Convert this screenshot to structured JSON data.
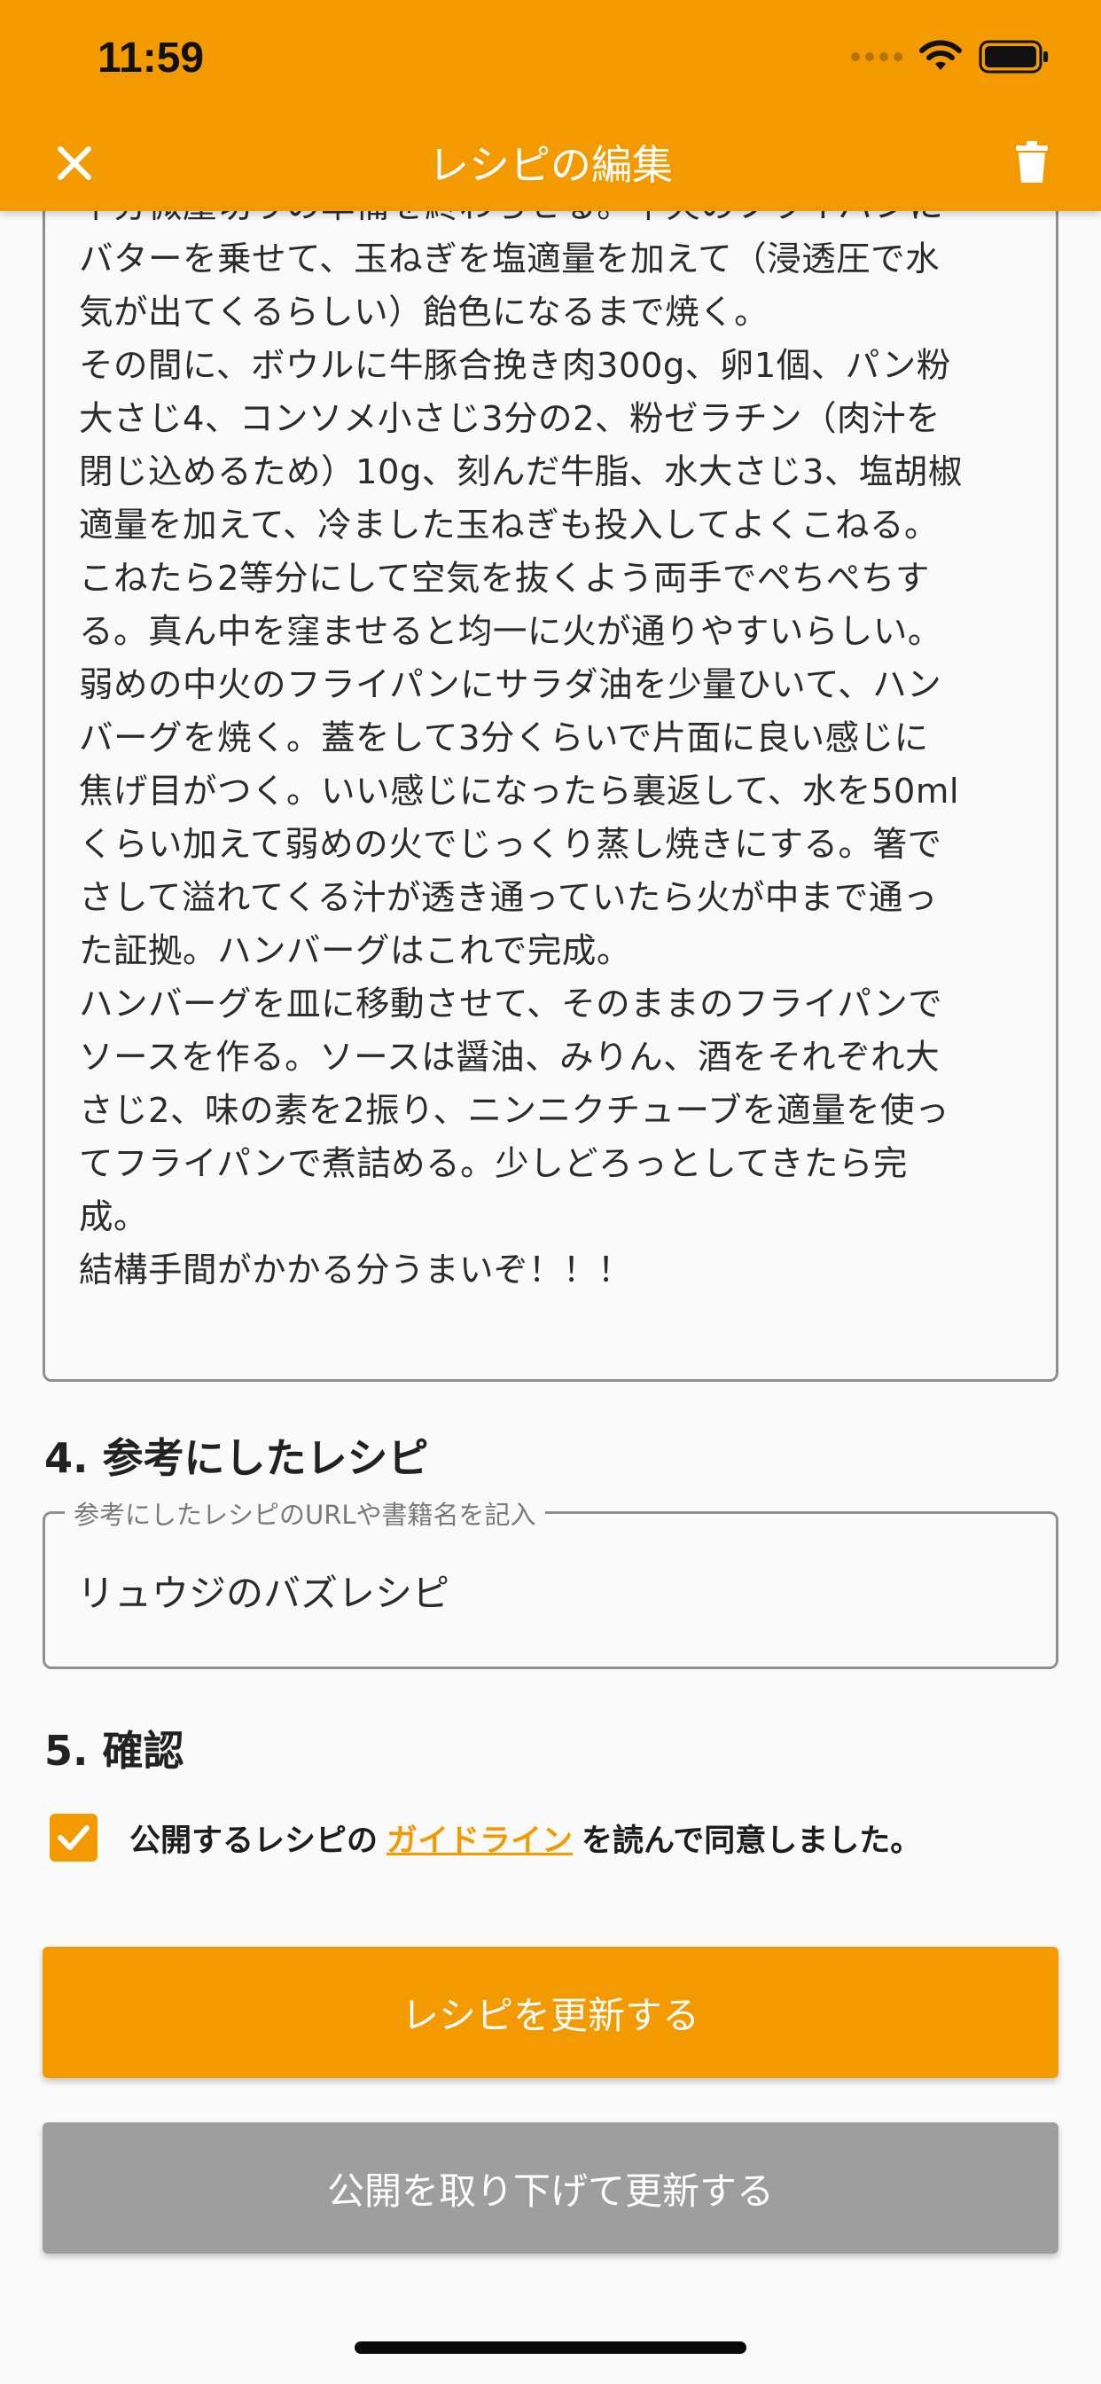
{
  "status_bar": {
    "time": "11:59"
  },
  "app_bar": {
    "title": "レシピの編集"
  },
  "icons": {
    "close": "close-icon",
    "trash": "trash-icon",
    "wifi": "wifi-icon",
    "battery": "battery-icon",
    "check": "check-icon"
  },
  "colors": {
    "accent": "#f39a00",
    "secondary_button": "#9e9e9e"
  },
  "steps_text": "半分微塵切りの準備を終わらせる。中火のフライパンに\nバターを乗せて、玉ねぎを塩適量を加えて（浸透圧で水\n気が出てくるらしい）飴色になるまで焼く。\nその間に、ボウルに牛豚合挽き肉300g、卵1個、パン粉\n大さじ4、コンソメ小さじ3分の2、粉ゼラチン（肉汁を\n閉じ込めるため）10g、刻んだ牛脂、水大さじ3、塩胡椒\n適量を加えて、冷ました玉ねぎも投入してよくこねる。\nこねたら2等分にして空気を抜くよう両手でぺちぺちす\nる。真ん中を窪ませると均一に火が通りやすいらしい。\n弱めの中火のフライパンにサラダ油を少量ひいて、ハン\nバーグを焼く。蓋をして3分くらいで片面に良い感じに\n焦げ目がつく。いい感じになったら裏返して、水を50ml\nくらい加えて弱めの火でじっくり蒸し焼きにする。箸で\nさして溢れてくる汁が透き通っていたら火が中まで通っ\nた証拠。ハンバーグはこれで完成。\nハンバーグを皿に移動させて、そのままのフライパンで\nソースを作る。ソースは醤油、みりん、酒をそれぞれ大\nさじ2、味の素を2振り、ニンニクチューブを適量を使っ\nてフライパンで煮詰める。少しどろっとしてきたら完\n成。\n結構手間がかかる分うまいぞ！！！",
  "reference_section": {
    "title": "4. 参考にしたレシピ",
    "field_label": "参考にしたレシピのURLや書籍名を記入",
    "field_value": "リュウジのバズレシピ"
  },
  "confirm_section": {
    "title": "5. 確認",
    "checked": true,
    "text_before": "公開するレシピの",
    "link_text": "ガイドライン",
    "text_after": "を読んで同意しました。"
  },
  "buttons": {
    "update": "レシピを更新する",
    "unpublish_update": "公開を取り下げて更新する"
  }
}
